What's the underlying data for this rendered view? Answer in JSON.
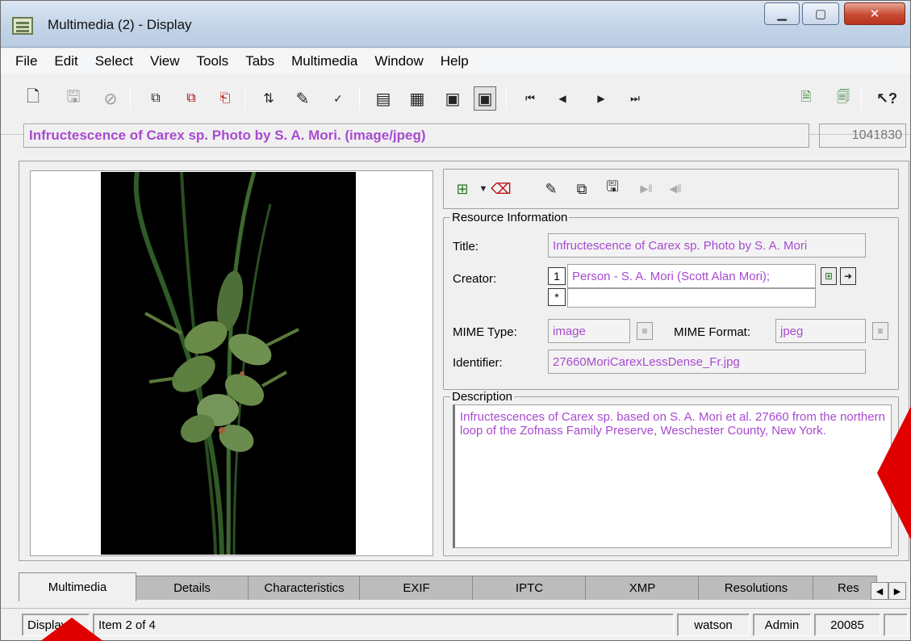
{
  "window": {
    "title": "Multimedia (2) - Display"
  },
  "menu": [
    "File",
    "Edit",
    "Select",
    "View",
    "Tools",
    "Tabs",
    "Multimedia",
    "Window",
    "Help"
  ],
  "toolbar": {
    "icons": [
      "new-icon",
      "save-icon",
      "cancel-icon",
      "select-icon",
      "select-all-icon",
      "deselect-icon",
      "sort-icon",
      "notes-icon",
      "spellcheck-icon",
      "form-view-icon",
      "grid-view-icon",
      "record-view-icon",
      "image-view-icon",
      "first-record-icon",
      "previous-record-icon",
      "next-record-icon",
      "last-record-icon",
      "copy-record-icon",
      "paste-record-icon",
      "help-icon"
    ]
  },
  "record": {
    "summary": "Infructescence of Carex sp. Photo by S. A. Mori. (image/jpeg)",
    "irn": "1041830"
  },
  "resource": {
    "legend": "Resource Information",
    "title_label": "Title:",
    "title_value": "Infructescence of Carex sp. Photo by S. A. Mori",
    "creator_label": "Creator:",
    "creator_index": "1",
    "creator_value": "Person - S. A. Mori (Scott Alan Mori);",
    "new_row_marker": "*",
    "mime_type_label": "MIME Type:",
    "mime_type_value": "image",
    "mime_format_label": "MIME Format:",
    "mime_format_value": "jpeg",
    "identifier_label": "Identifier:",
    "identifier_value": "27660MoriCarexLessDense_Fr.jpg"
  },
  "description": {
    "legend": "Description",
    "text": "Infructescences of Carex sp. based on S. A. Mori et al. 27660 from the northern loop of the Zofnass Family Preserve, Weschester County, New York."
  },
  "tabs": [
    "Multimedia",
    "Details",
    "Characteristics",
    "EXIF",
    "IPTC",
    "XMP",
    "Resolutions",
    "Res"
  ],
  "status": {
    "mode": "Display",
    "item": "Item 2 of 4",
    "user": "watson",
    "group": "Admin",
    "count": "20085"
  },
  "colors": {
    "value_text": "#a84ad0",
    "marker": "#e00000"
  }
}
